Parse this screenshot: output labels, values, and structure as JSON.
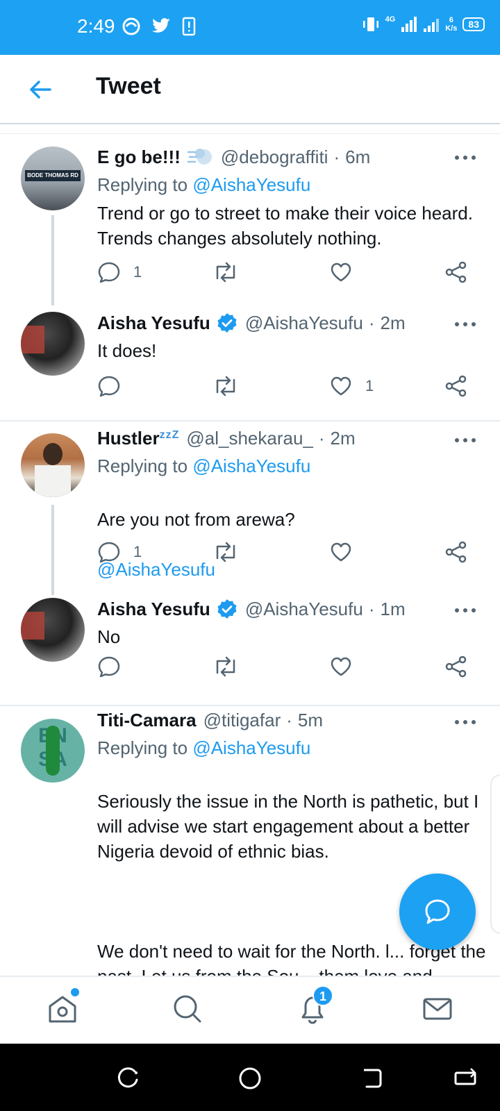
{
  "status_bar": {
    "time": "2:49",
    "network": "4G",
    "speed_value": "6",
    "speed_unit": "K/s",
    "battery": "83"
  },
  "header": {
    "title": "Tweet"
  },
  "tweets": [
    {
      "name": "E go be!!!",
      "handle": "@debograffiti",
      "time": "6m",
      "replying_label": "Replying to",
      "replying_to": "@AishaYesufu",
      "text": "Trend or go to street to make their voice heard. Trends changes absolutely nothing.",
      "reply_count": "1",
      "like_count": ""
    },
    {
      "name": "Aisha Yesufu",
      "handle": "@AishaYesufu",
      "time": "2m",
      "text": "It does!",
      "reply_count": "",
      "like_count": "1"
    },
    {
      "name": "Hustler",
      "name_suffix": "zzZ",
      "handle": "@al_shekarau_",
      "time": "2m",
      "replying_label": "Replying to",
      "replying_to": "@AishaYesufu",
      "text": "Are you not from arewa?",
      "text_mention": "@AishaYesufu",
      "reply_count": "1",
      "like_count": ""
    },
    {
      "name": "Aisha Yesufu",
      "handle": "@AishaYesufu",
      "time": "1m",
      "text": "No",
      "reply_count": "",
      "like_count": ""
    },
    {
      "name": "Titi-Camara",
      "handle": "@titigafar",
      "time": "5m",
      "replying_label": "Replying to",
      "replying_to": "@AishaYesufu",
      "text_p1": "Seriously the issue in the North is pathetic, but I will advise we start engagement about a better Nigeria devoid of ethnic bias.",
      "text_p2": "We don't need to wait for the North. l... forget the past. Let us from the Sou... them love and empathy. This might s... a better Nigeria."
    }
  ],
  "dot_separator": "·",
  "bottom_nav": {
    "notifications_badge": "1"
  },
  "colors": {
    "brand": "#1da1f2",
    "link": "#1d9bf0",
    "muted": "#536471"
  }
}
